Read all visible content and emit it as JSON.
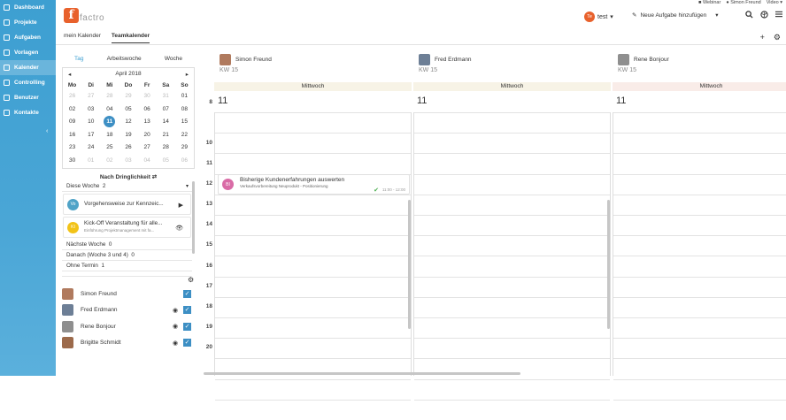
{
  "sidebar": {
    "items": [
      {
        "label": "Dashboard",
        "icon": "dashboard-icon"
      },
      {
        "label": "Projekte",
        "icon": "projects-icon"
      },
      {
        "label": "Aufgaben",
        "icon": "tasks-icon"
      },
      {
        "label": "Vorlagen",
        "icon": "templates-icon"
      },
      {
        "label": "Kalender",
        "icon": "calendar-icon"
      },
      {
        "label": "Controlling",
        "icon": "controlling-icon"
      },
      {
        "label": "Benutzer",
        "icon": "users-icon"
      },
      {
        "label": "Kontakte",
        "icon": "contacts-icon"
      }
    ],
    "active_index": 4,
    "collapse_glyph": "‹"
  },
  "topbar": {
    "webinar": "Webinar",
    "username": "Simon Freund",
    "video": "Video",
    "logo_letter": "f",
    "logo_text": "factro",
    "user_initials": "Te",
    "user_label": "test",
    "new_task": "Neue Aufgabe hinzufügen"
  },
  "tabs": {
    "mine": "mein Kalender",
    "team": "Teamkalender"
  },
  "viewtabs": {
    "day": "Tag",
    "workweek": "Arbeitswoche",
    "week": "Woche"
  },
  "mini_calendar": {
    "month": "April 2018",
    "weekdays": [
      "Mo",
      "Di",
      "Mi",
      "Do",
      "Fr",
      "Sa",
      "So"
    ],
    "days": [
      [
        "26",
        "27",
        "28",
        "29",
        "30",
        "31",
        "01"
      ],
      [
        "02",
        "03",
        "04",
        "05",
        "06",
        "07",
        "08"
      ],
      [
        "09",
        "10",
        "11",
        "12",
        "13",
        "14",
        "15"
      ],
      [
        "16",
        "17",
        "18",
        "19",
        "20",
        "21",
        "22"
      ],
      [
        "23",
        "24",
        "25",
        "26",
        "27",
        "28",
        "29"
      ],
      [
        "30",
        "01",
        "02",
        "03",
        "04",
        "05",
        "06"
      ]
    ],
    "muted": [
      [
        0,
        0
      ],
      [
        0,
        1
      ],
      [
        0,
        2
      ],
      [
        0,
        3
      ],
      [
        0,
        4
      ],
      [
        0,
        5
      ],
      [
        5,
        1
      ],
      [
        5,
        2
      ],
      [
        5,
        3
      ],
      [
        5,
        4
      ],
      [
        5,
        5
      ],
      [
        5,
        6
      ]
    ],
    "today": [
      2,
      2
    ]
  },
  "priority": {
    "title": "Nach Dringlichkeit ⇄",
    "this_week": "Diese Woche",
    "this_week_count": "2",
    "cards": [
      {
        "initials": "Vo",
        "color": "#4fa3c7",
        "title": "Vorgehensweise zur Kennzeic...",
        "sub": "",
        "action": "▶"
      },
      {
        "initials": "KI",
        "color": "#f2c318",
        "title": "Kick-Off Veranstaltung für alle...",
        "sub": "Einführung Projektmanagement mit fa...",
        "action": "👁"
      }
    ],
    "next_week": "Nächste Woche",
    "next_week_count": "0",
    "later": "Danach (Woche 3 und 4)",
    "later_count": "0",
    "no_date": "Ohne Termin",
    "no_date_count": "1"
  },
  "people": [
    {
      "name": "Simon Freund",
      "eye": false,
      "color": "#b07a5e"
    },
    {
      "name": "Fred Erdmann",
      "eye": true,
      "color": "#6d7f96"
    },
    {
      "name": "Rene Bonjour",
      "eye": true,
      "color": "#8f8f8f"
    },
    {
      "name": "Brigitte Schmidt",
      "eye": true,
      "color": "#9c6a4b"
    }
  ],
  "columns": [
    {
      "name": "Simon Freund",
      "kw": "KW 15",
      "day": "Mittwoch",
      "daynum": "11",
      "color": "#b07a5e"
    },
    {
      "name": "Fred Erdmann",
      "kw": "KW 15",
      "day": "Mittwoch",
      "daynum": "11",
      "color": "#6d7f96"
    },
    {
      "name": "Rene Bonjour",
      "kw": "KW 15",
      "day": "Mittwoch",
      "daynum": "11",
      "color": "#8f8f8f"
    }
  ],
  "hours": [
    "8",
    "10",
    "11",
    "12",
    "13",
    "14",
    "15",
    "16",
    "17",
    "18",
    "19",
    "20"
  ],
  "event": {
    "initials": "BI",
    "title": "Bisherige Kundenerfahrungen auswerten",
    "sub": "Verkaufsvorbereitung Neuprodukt - Positionierung",
    "time": "11:00 - 12:00"
  }
}
